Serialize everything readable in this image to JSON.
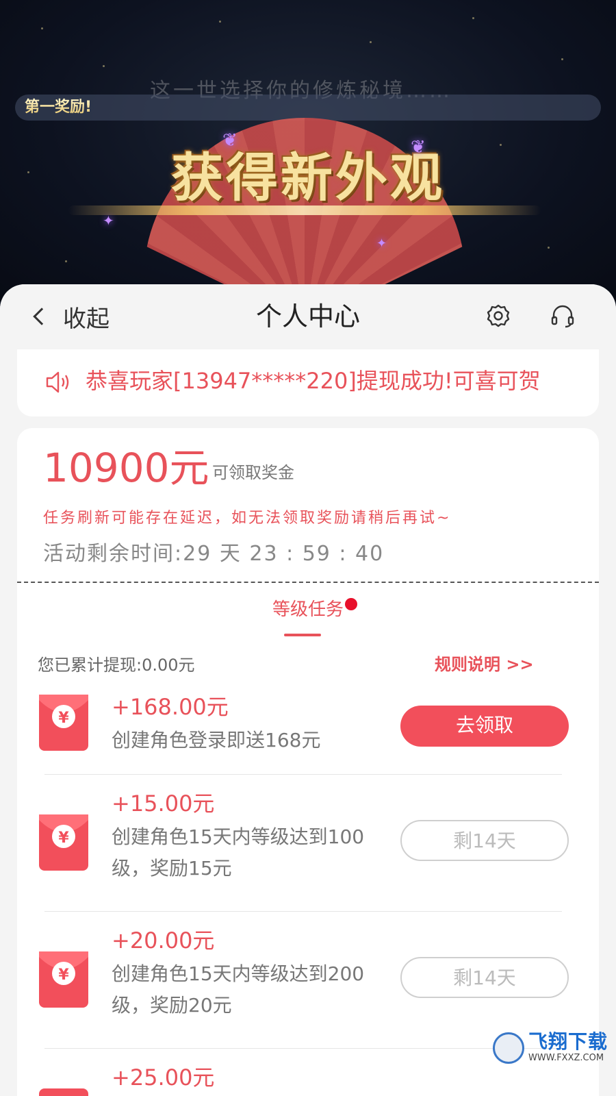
{
  "game": {
    "subtitle": "这一世选择你的修炼秘境……",
    "reward_label": "第一奖励!",
    "banner_title": "获得新外观"
  },
  "header": {
    "back_label": "收起",
    "title": "个人中心",
    "icons": [
      "gear-icon",
      "headset-icon"
    ]
  },
  "notice": {
    "text": "恭喜玩家[13947*****220]提现成功!可喜可贺"
  },
  "bonus": {
    "amount": "10900元",
    "amount_label": "可领取奖金",
    "warning": "任务刷新可能存在延迟，如无法领取奖励请稍后再试~",
    "timer": "活动剩余时间:29 天 23 : 59 : 40"
  },
  "tabs": [
    {
      "label": "等级任务",
      "active": true,
      "has_dot": true
    }
  ],
  "withdrawn": "您已累计提现:0.00元",
  "rules_link": "规则说明 >>",
  "tasks": [
    {
      "amount": "+168.00元",
      "desc": "创建角色登录即送168元",
      "button": "去领取",
      "state": "claimable"
    },
    {
      "amount": "+15.00元",
      "desc": "创建角色15天内等级达到100级，奖励15元",
      "button": "剩14天",
      "state": "pending"
    },
    {
      "amount": "+20.00元",
      "desc": "创建角色15天内等级达到200级，奖励20元",
      "button": "剩14天",
      "state": "pending"
    },
    {
      "amount": "+25.00元",
      "desc": "",
      "button": "",
      "state": "pending"
    }
  ],
  "watermark": {
    "name": "飞翔下载",
    "url": "WWW.FXXZ.COM"
  },
  "colors": {
    "accent": "#e8525a",
    "primary_button": "#f24f5b",
    "dot": "#e8102b"
  }
}
